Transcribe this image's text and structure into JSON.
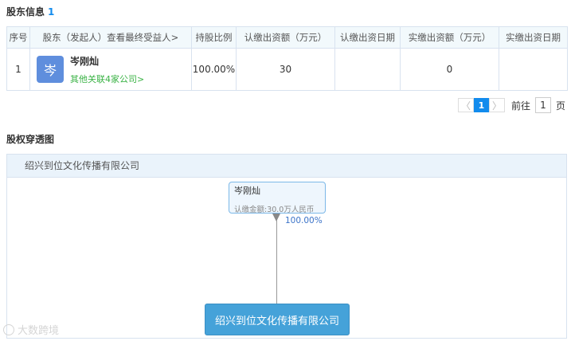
{
  "shareholders": {
    "title": "股东信息",
    "count": "1",
    "columns": [
      "序号",
      "股东（发起人）查看最终受益人>",
      "持股比例",
      "认缴出资额（万元）",
      "认缴出资日期",
      "实缴出资额（万元）",
      "实缴出资日期"
    ],
    "rows": [
      {
        "index": "1",
        "avatar_char": "岑",
        "name": "岑刚灿",
        "link": "其他关联4家公司>",
        "ratio": "100.00%",
        "subscribed_amount": "30",
        "subscribed_date": "",
        "paid_amount": "0",
        "paid_date": ""
      }
    ],
    "avatar_color": "#5f8edd"
  },
  "pagination": {
    "prev": "〈",
    "current": "1",
    "next": "〉",
    "goto_label": "前往",
    "page_value": "1",
    "page_suffix": "页"
  },
  "equity_chart": {
    "title": "股权穿透图",
    "company_header": "绍兴到位文化传播有限公司",
    "top_node": {
      "name": "岑刚灿",
      "amount": "认缴金额:30.0万人民币"
    },
    "percentage": "100.00%",
    "bottom_node": "绍兴到位文化传播有限公司"
  },
  "watermark": "大数跨境",
  "colors": {
    "accent": "#128bed",
    "link_green": "#3bb346",
    "node_blue": "#45a2d9"
  }
}
